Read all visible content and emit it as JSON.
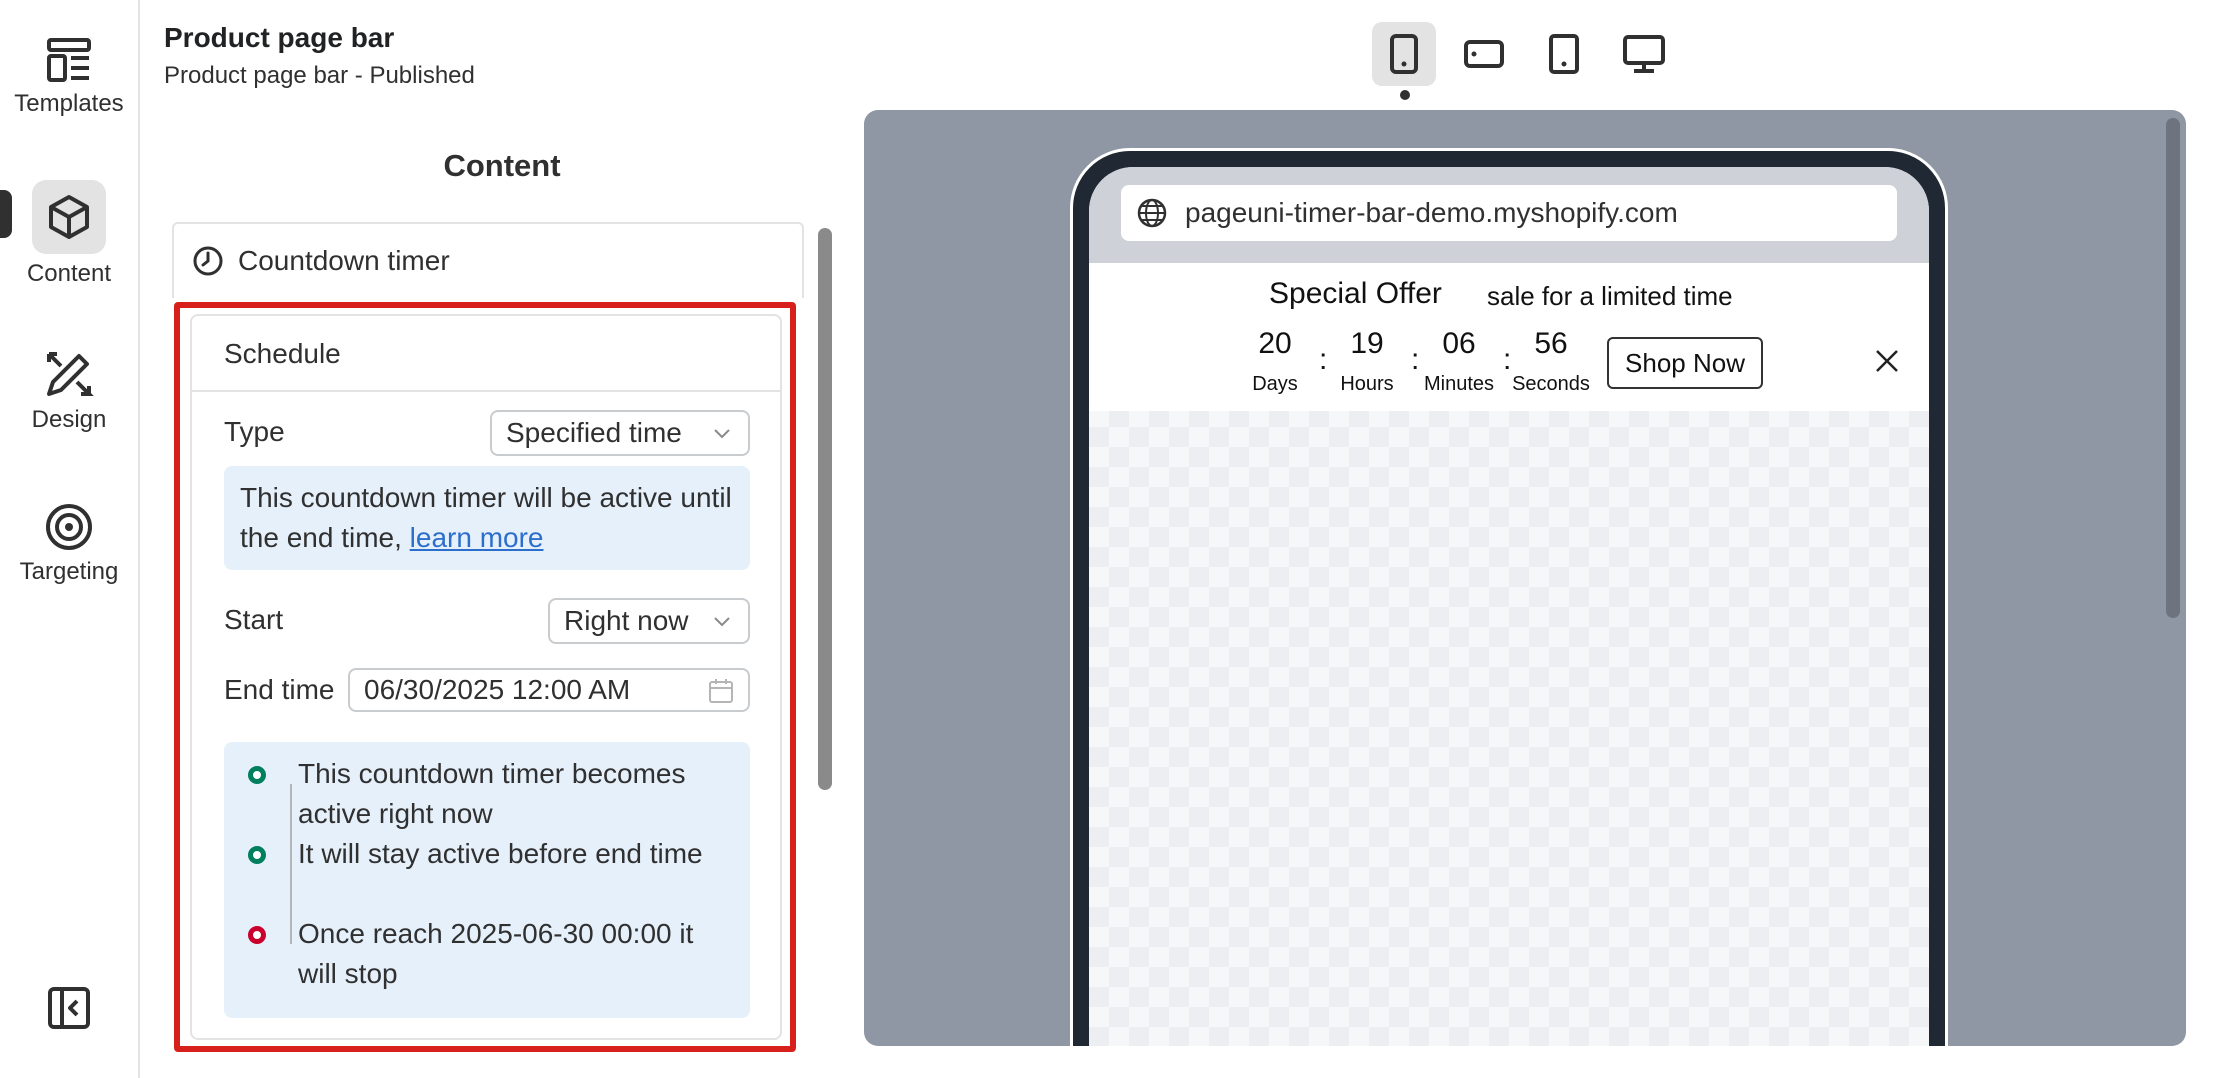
{
  "header": {
    "title": "Product page bar",
    "subtitle": "Product page bar - Published"
  },
  "rail": {
    "items": [
      {
        "label": "Templates",
        "icon": "templates-icon"
      },
      {
        "label": "Content",
        "icon": "cube-icon",
        "active": true
      },
      {
        "label": "Design",
        "icon": "design-icon"
      },
      {
        "label": "Targeting",
        "icon": "target-icon"
      }
    ],
    "collapse_icon": "sidebar-collapse-icon"
  },
  "devices": [
    {
      "icon": "mobile-icon",
      "active": true
    },
    {
      "icon": "mobile-landscape-icon"
    },
    {
      "icon": "tablet-icon"
    },
    {
      "icon": "desktop-icon"
    }
  ],
  "panel": {
    "heading": "Content",
    "section": "Countdown timer",
    "card_title": "Schedule",
    "type_label": "Type",
    "type_value": "Specified time",
    "info_text": "This countdown timer will be active until the end time, ",
    "info_link": "learn more",
    "start_label": "Start",
    "start_value": "Right now",
    "end_label": "End time",
    "end_value": "06/30/2025 12:00 AM",
    "timeline": [
      {
        "text": "This countdown timer becomes active right now",
        "status": "green"
      },
      {
        "text": "It will stay active before end time",
        "status": "green"
      },
      {
        "text": "Once reach 2025-06-30 00:00 it will stop",
        "status": "red"
      }
    ]
  },
  "preview": {
    "url": "pageuni-timer-bar-demo.myshopify.com",
    "offer_title": "Special Offer",
    "offer_subtitle": "sale for a limited time",
    "countdown": {
      "days": "20",
      "days_label": "Days",
      "hours": "19",
      "hours_label": "Hours",
      "minutes": "06",
      "minutes_label": "Minutes",
      "seconds": "56",
      "seconds_label": "Seconds",
      "separator": ":"
    },
    "button": "Shop Now"
  },
  "colors": {
    "highlight": "#d7201c",
    "info_bg": "#e6f0fb",
    "link": "#2c6ecb",
    "timeline_green": "#007f5f",
    "timeline_red": "#c9002b",
    "preview_bg": "#8e97a3"
  }
}
